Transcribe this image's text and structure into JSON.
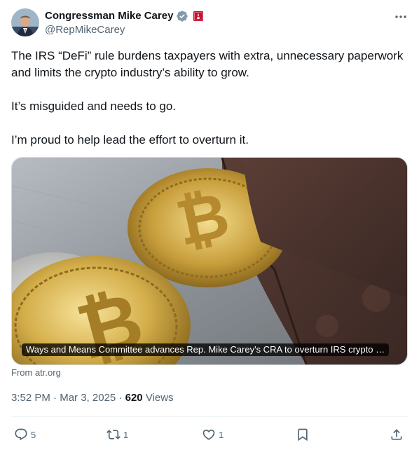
{
  "author": {
    "name": "Congressman Mike Carey",
    "handle": "@RepMikeCarey",
    "verified_badge_icon": "verified-badge-icon",
    "affiliation_icon": "government-flag-icon"
  },
  "tweet": {
    "paragraphs": [
      "The IRS “DeFi” rule burdens taxpayers with extra, unnecessary paperwork and limits the crypto industry’s ability to grow.",
      "It’s misguided and needs to go.",
      "I’m proud to help lead the effort to overturn it."
    ]
  },
  "card": {
    "caption": "Ways and Means Committee advances Rep. Mike Carey's CRA to overturn IRS crypto …",
    "source": "From atr.org",
    "image": "photo of gold bitcoin coins next to a brown leather wallet"
  },
  "meta": {
    "time": "3:52 PM",
    "date": "Mar 3, 2025",
    "separator": "·",
    "views_count": "620",
    "views_label": "Views"
  },
  "actions": {
    "replies": "5",
    "reposts": "1",
    "likes": "1",
    "bookmarks": "",
    "share": ""
  },
  "colors": {
    "text": "#0f1419",
    "secondary": "#536471",
    "verified": "#829aab",
    "border": "#cfd9de"
  }
}
